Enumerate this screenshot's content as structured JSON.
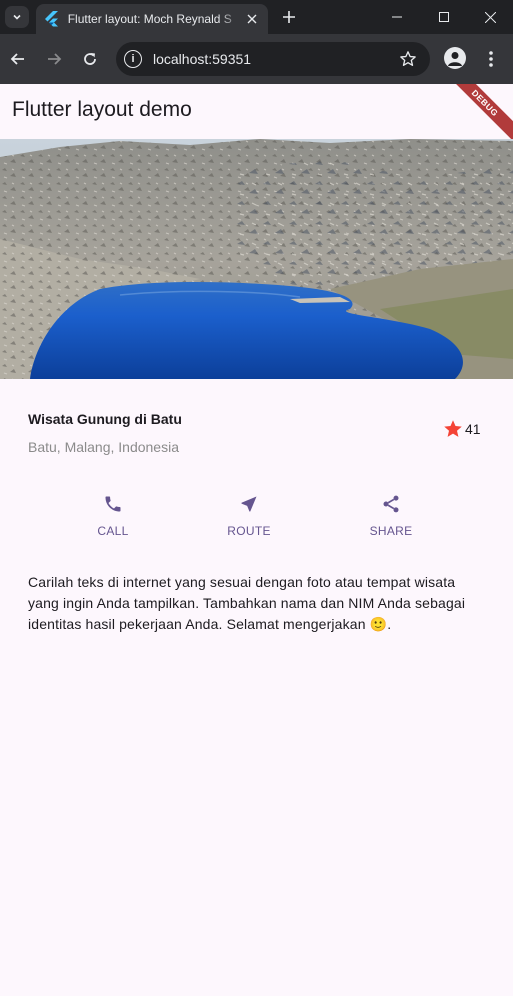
{
  "browser": {
    "tab_title": "Flutter layout: Moch Reynald S",
    "url": "localhost:59351"
  },
  "app": {
    "title": "Flutter layout demo",
    "debug_banner": "DEBUG",
    "place": {
      "name": "Wisata Gunung di Batu",
      "location": "Batu, Malang, Indonesia",
      "rating": "41"
    },
    "buttons": [
      {
        "label": "CALL",
        "icon": "phone-icon"
      },
      {
        "label": "ROUTE",
        "icon": "near-me-icon"
      },
      {
        "label": "SHARE",
        "icon": "share-icon"
      }
    ],
    "description": "Carilah teks di internet yang sesuai dengan foto atau tempat wisata yang ingin Anda tampilkan. Tambahkan nama dan NIM Anda sebagai identitas hasil pekerjaan Anda. Selamat mengerjakan 🙂.",
    "colors": {
      "accent": "#65558f",
      "star": "#f44336",
      "background": "#fdf7fd"
    }
  }
}
